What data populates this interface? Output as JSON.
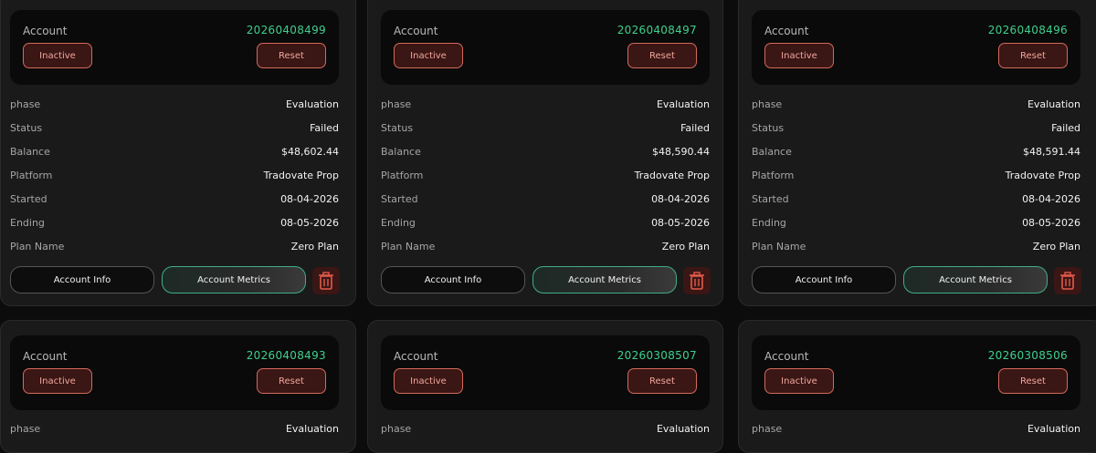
{
  "labels": {
    "account": "Account",
    "inactive": "Inactive",
    "reset": "Reset",
    "phase": "phase",
    "status": "Status",
    "balance": "Balance",
    "platform": "Platform",
    "started": "Started",
    "ending": "Ending",
    "plan_name": "Plan Name",
    "account_info": "Account Info",
    "account_metrics": "Account Metrics"
  },
  "colors": {
    "account_number": "#3fcf8e",
    "danger_border": "#d46a5c",
    "danger_bg": "#3a1614",
    "metrics_border": "#3fae86"
  },
  "cards": [
    {
      "account_number": "20260408499",
      "phase": "Evaluation",
      "status": "Failed",
      "balance": "$48,602.44",
      "platform": "Tradovate Prop",
      "started": "08-04-2026",
      "ending": "08-05-2026",
      "plan_name": "Zero Plan"
    },
    {
      "account_number": "20260408497",
      "phase": "Evaluation",
      "status": "Failed",
      "balance": "$48,590.44",
      "platform": "Tradovate Prop",
      "started": "08-04-2026",
      "ending": "08-05-2026",
      "plan_name": "Zero Plan"
    },
    {
      "account_number": "20260408496",
      "phase": "Evaluation",
      "status": "Failed",
      "balance": "$48,591.44",
      "platform": "Tradovate Prop",
      "started": "08-04-2026",
      "ending": "08-05-2026",
      "plan_name": "Zero Plan"
    },
    {
      "account_number": "20260408493",
      "phase": "Evaluation"
    },
    {
      "account_number": "20260308507",
      "phase": "Evaluation"
    },
    {
      "account_number": "20260308506",
      "phase": "Evaluation"
    }
  ]
}
